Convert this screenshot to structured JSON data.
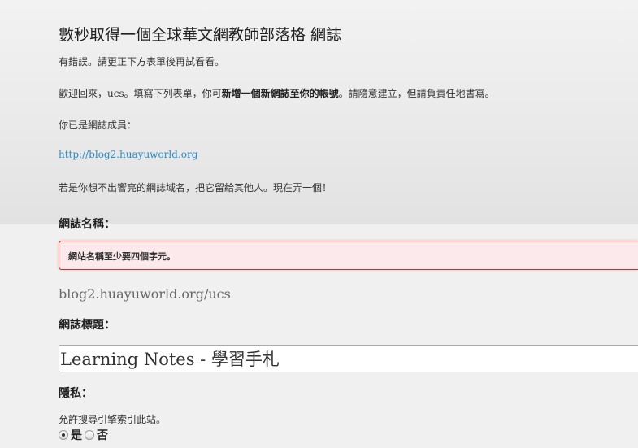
{
  "header": {
    "title": "數秒取得一個全球華文網教師部落格 網誌"
  },
  "messages": {
    "error_summary": "有錯誤。請更正下方表單後再試看看。",
    "welcome_prefix": "歡迎回來，ucs。填寫下列表單，你可",
    "welcome_bold": "新增一個新網誌至你的帳號",
    "welcome_suffix": "。請隨意建立，但請負責任地書寫。",
    "member_of": "你已是網誌成員：",
    "existing_blog_link": "http://blog2.huayuworld.org",
    "cant_think": "若是你想不出響亮的網誌域名，把它留給其他人。現在弄一個！"
  },
  "form": {
    "blog_name_label": "網誌名稱：",
    "blog_name_error": "網站名稱至少要四個字元。",
    "blog_domain": "blog2.huayuworld.org/ucs",
    "blog_title_label": "網誌標題：",
    "blog_title_value": "Learning Notes - 學習手札",
    "privacy_label": "隱私：",
    "privacy_desc": "允許搜尋引擎索引此站。",
    "privacy_yes": "是",
    "privacy_no": "否",
    "privacy_selected": "yes"
  },
  "colors": {
    "link": "#2b8cc4",
    "error_border": "#c9302c",
    "error_bg": "#fce9ec"
  }
}
